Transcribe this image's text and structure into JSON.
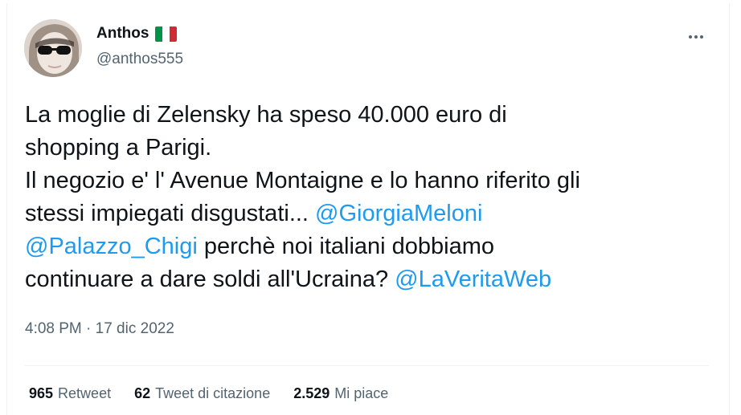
{
  "author": {
    "display_name": "Anthos",
    "flag": "italy-flag",
    "handle": "@anthos555"
  },
  "more_icon": "more-horizontal-icon",
  "tweet": {
    "lines": [
      [
        {
          "t": "La moglie di Zelensky ha speso 40.000 euro di"
        }
      ],
      [
        {
          "t": "shopping a Parigi."
        }
      ],
      [
        {
          "t": "Il negozio e' l' Avenue Montaigne e lo hanno riferito gli"
        }
      ],
      [
        {
          "t": "stessi impiegati disgustati... "
        },
        {
          "t": "@GiorgiaMeloni",
          "m": true
        }
      ],
      [
        {
          "t": "@Palazzo_Chigi",
          "m": true
        },
        {
          "t": " perchè noi italiani dobbiamo"
        }
      ],
      [
        {
          "t": "continuare a dare soldi all'Ucraina? "
        },
        {
          "t": "@LaVeritaWeb",
          "m": true
        }
      ]
    ]
  },
  "timestamp": "4:08 PM · 17 dic 2022",
  "stats": {
    "retweets": {
      "count": "965",
      "label": "Retweet"
    },
    "quotes": {
      "count": "62",
      "label": "Tweet di citazione"
    },
    "likes": {
      "count": "2.529",
      "label": "Mi piace"
    }
  },
  "colors": {
    "text": "#0f1419",
    "secondary": "#536471",
    "link": "#1d9bf0",
    "divider": "#eff3f4"
  }
}
